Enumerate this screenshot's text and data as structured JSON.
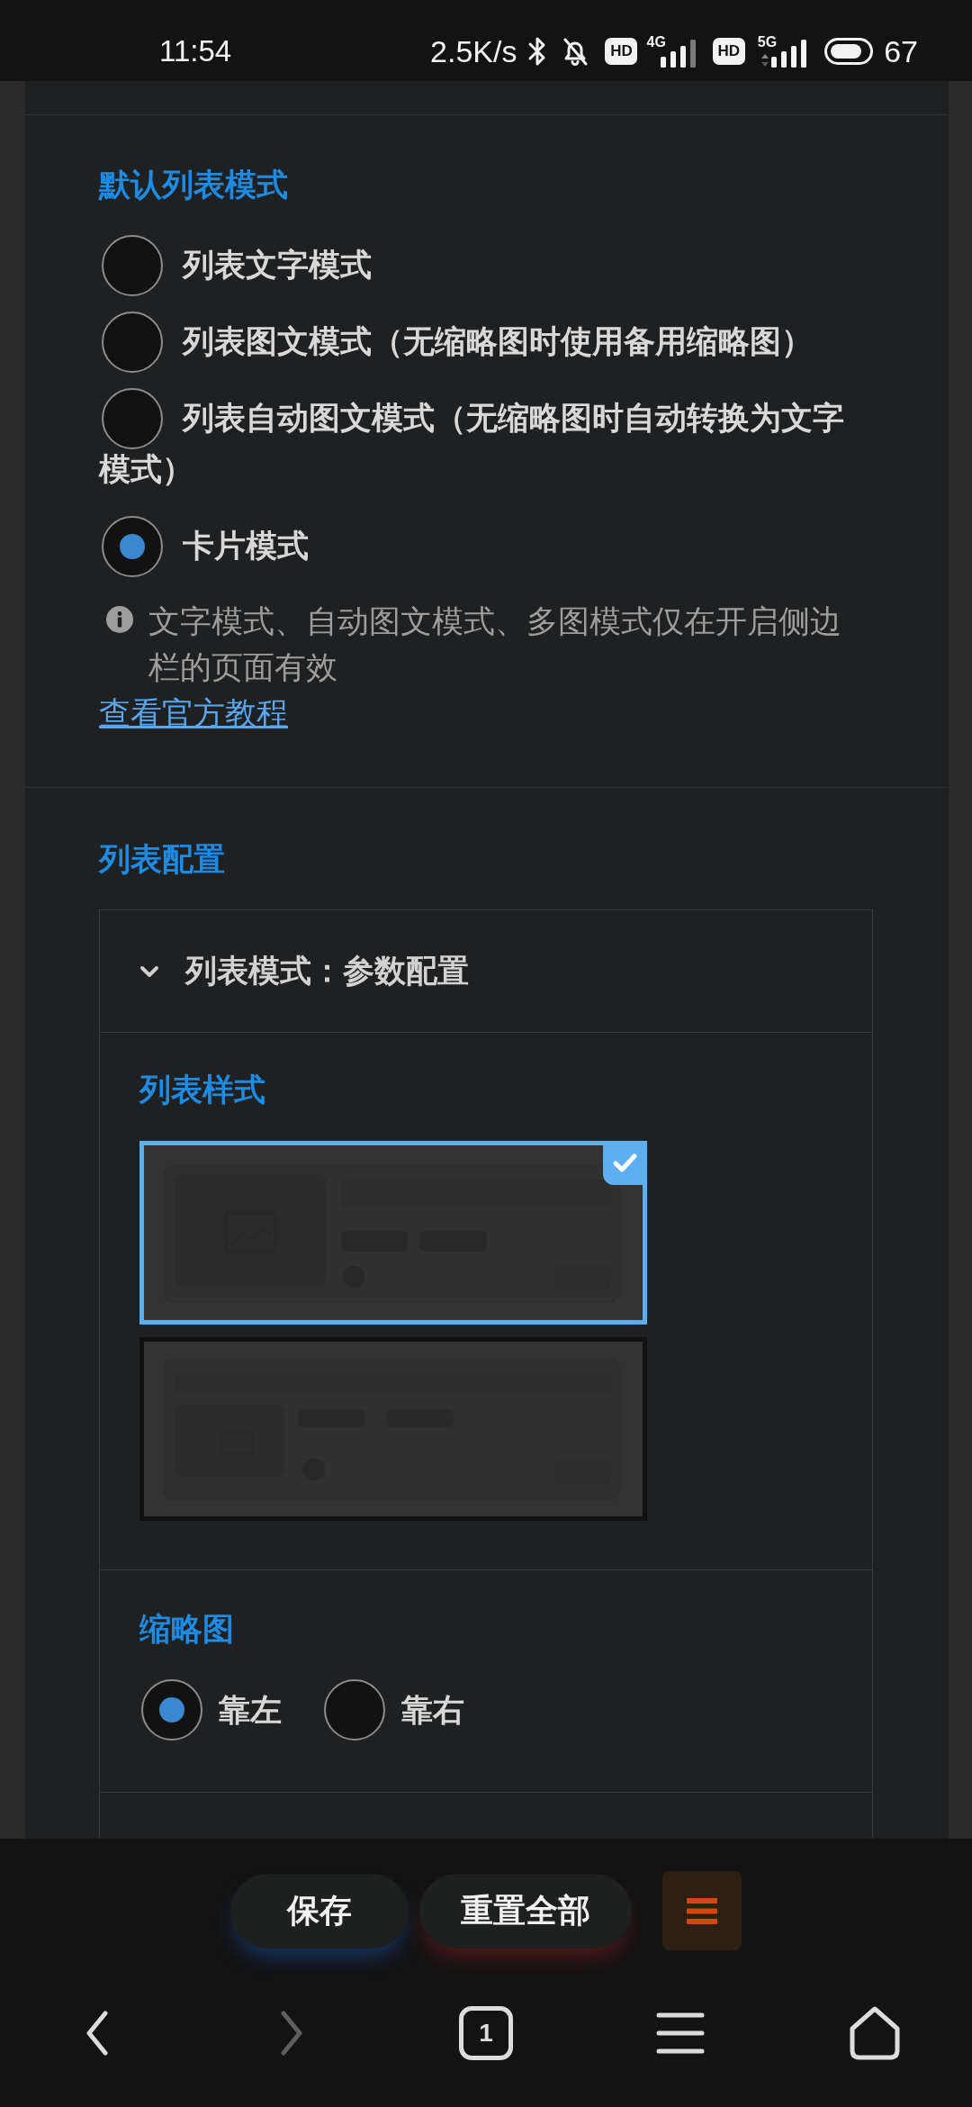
{
  "status_bar": {
    "time": "11:54",
    "net_speed": "2.5K/s",
    "sims": [
      {
        "hd": "HD",
        "network": "4G"
      },
      {
        "hd": "HD",
        "network": "5G"
      }
    ],
    "battery": "67"
  },
  "default_list_mode": {
    "title": "默认列表模式",
    "options": [
      {
        "label": "列表文字模式",
        "selected": false
      },
      {
        "label": "列表图文模式（无缩略图时使用备用缩略图）",
        "selected": false
      },
      {
        "label": "列表自动图文模式（无缩略图时自动转换为文字模式）",
        "selected": false
      },
      {
        "label": "卡片模式",
        "selected": true
      }
    ],
    "note": "文字模式、自动图文模式、多图模式仅在开启侧边栏的页面有效",
    "link": "查看官方教程"
  },
  "list_config": {
    "title": "列表配置",
    "panel": {
      "title": "列表模式：参数配置",
      "expanded": true,
      "list_style": {
        "title": "列表样式",
        "options": [
          {
            "kind": "thumbnail_left",
            "selected": true
          },
          {
            "kind": "title_top",
            "selected": false
          }
        ]
      },
      "thumbnail": {
        "title": "缩略图",
        "options": [
          {
            "label": "靠左",
            "selected": true
          },
          {
            "label": "靠右",
            "selected": false
          }
        ]
      }
    }
  },
  "action_bar": [
    {
      "kind": "save",
      "label": "保存"
    },
    {
      "kind": "reset",
      "label": "重置全部"
    },
    {
      "kind": "menu"
    }
  ],
  "nav_bar": [
    {
      "kind": "back",
      "disabled": false
    },
    {
      "kind": "forward",
      "disabled": true
    },
    {
      "kind": "tabs",
      "label": "1",
      "disabled": false
    },
    {
      "kind": "menu",
      "disabled": false
    },
    {
      "kind": "home",
      "disabled": false
    }
  ]
}
